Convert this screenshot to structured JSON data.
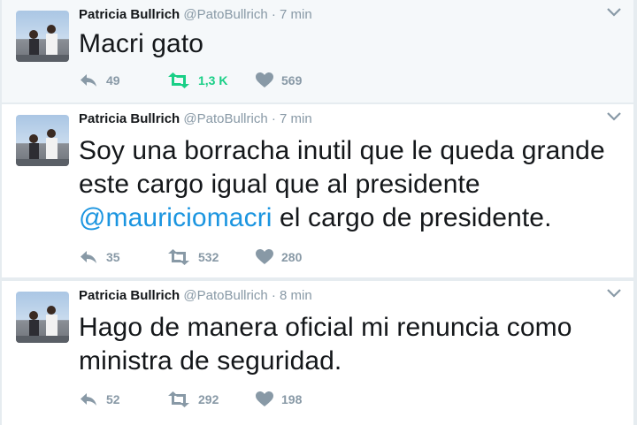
{
  "tweets": [
    {
      "name": "Patricia Bullrich",
      "handle": "@PatoBullrich",
      "time": "7 min",
      "text_before": "Macri gato",
      "mention": "",
      "text_after": "",
      "replies": "49",
      "retweets": "1,3 K",
      "likes": "569",
      "retweeted": true
    },
    {
      "name": "Patricia Bullrich",
      "handle": "@PatoBullrich",
      "time": "7 min",
      "text_before": "Soy una borracha inutil que le queda grande este cargo igual que al presidente ",
      "mention": "@mauriciomacri",
      "text_after": " el cargo de presidente.",
      "replies": "35",
      "retweets": "532",
      "likes": "280",
      "retweeted": false
    },
    {
      "name": "Patricia Bullrich",
      "handle": "@PatoBullrich",
      "time": "8 min",
      "text_before": "Hago de manera oficial mi renuncia como ministra de seguridad.",
      "mention": "",
      "text_after": "",
      "replies": "52",
      "retweets": "292",
      "likes": "198",
      "retweeted": false
    }
  ],
  "separator": "·",
  "colors": {
    "background": "#e6ecf0",
    "tweet_hover": "#f5f8fa",
    "tweet": "#ffffff",
    "muted": "#8899a6",
    "link": "#1b95e0",
    "retweet_active": "#19cf86"
  },
  "icons": {
    "reply": "reply-icon",
    "retweet": "retweet-icon",
    "like": "heart-icon",
    "more": "chevron-down-icon"
  }
}
